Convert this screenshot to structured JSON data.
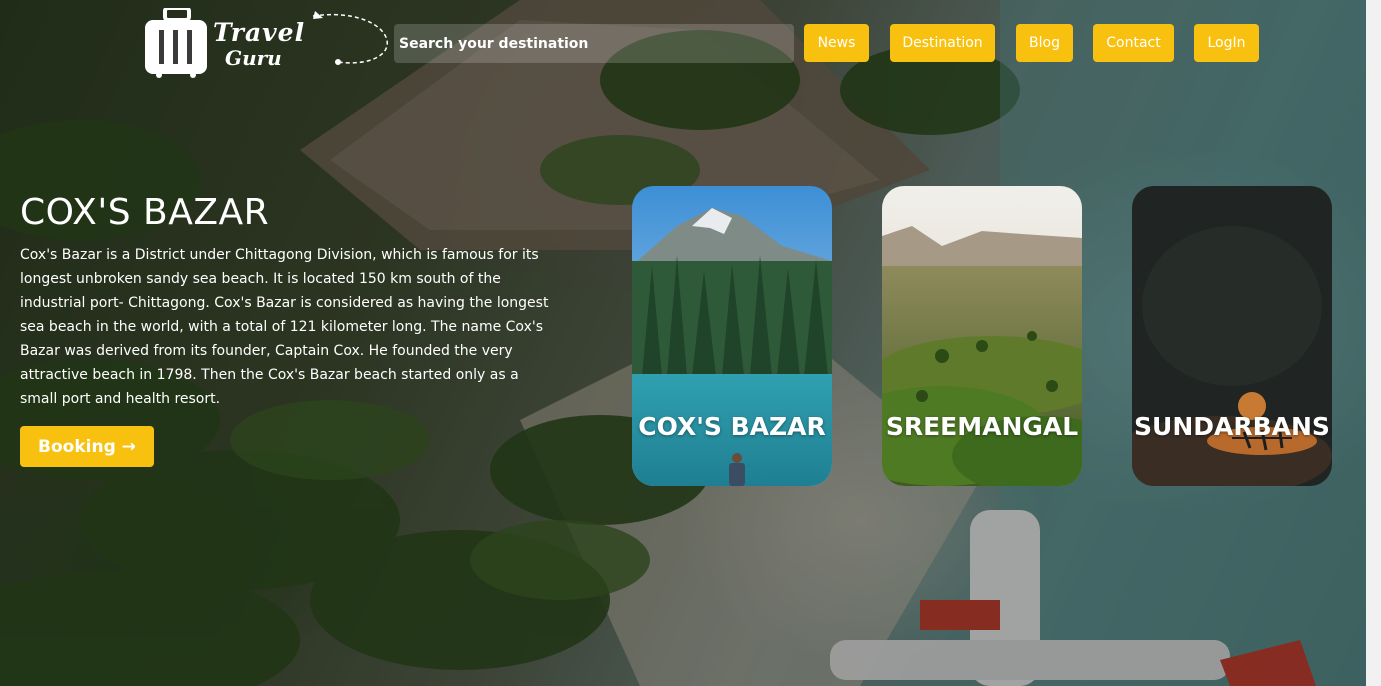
{
  "header": {
    "logo_line1": "Travel",
    "logo_line2": "Guru",
    "search_placeholder": "Search your destination",
    "nav": [
      {
        "label": "News"
      },
      {
        "label": "Destination"
      },
      {
        "label": "Blog"
      },
      {
        "label": "Contact"
      },
      {
        "label": "LogIn"
      }
    ]
  },
  "hero": {
    "title": "COX'S BAZAR",
    "description": "Cox's Bazar is a District under Chittagong Division, which is famous for its longest unbroken sandy sea beach. It is located 150 km south of the industrial port- Chittagong. Cox's Bazar is considered as having the longest sea beach in the world, with a total of 121 kilometer long. The name Cox's Bazar was derived from its founder, Captain Cox. He founded the very attractive beach in 1798. Then the Cox's Bazar beach started only as a small port and health resort.",
    "button_label": "Booking →"
  },
  "destinations": [
    {
      "label": "COX'S BAZAR"
    },
    {
      "label": "SREEMANGAL"
    },
    {
      "label": "SUNDARBANS"
    }
  ],
  "colors": {
    "accent": "#f9c10f",
    "text": "#ffffff"
  },
  "icons": [
    "suitcase-icon"
  ]
}
